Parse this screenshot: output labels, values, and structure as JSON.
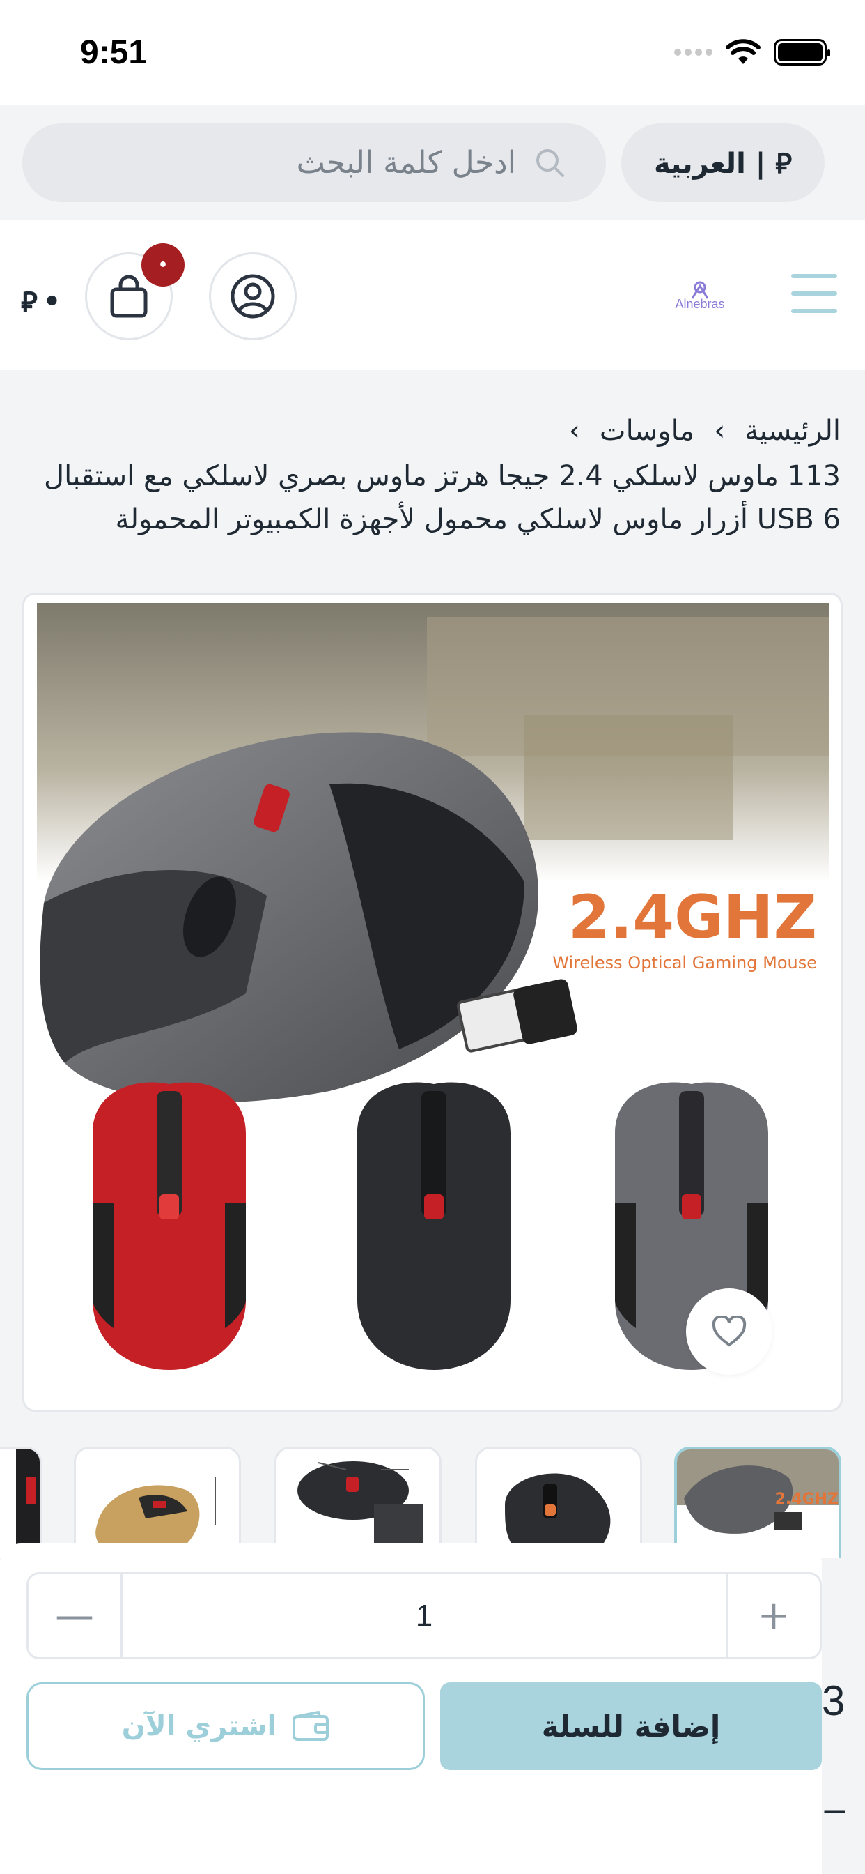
{
  "status_bar": {
    "time": "9:51"
  },
  "top_bar": {
    "language_currency": "العربية | ⃁",
    "search_placeholder": "ادخل كلمة البحث"
  },
  "header": {
    "logo_text": "Alnebras",
    "cart_badge": "•",
    "cart_total": "•",
    "currency_symbol": "⃁"
  },
  "breadcrumb": {
    "items": [
      "الرئيسية",
      "ماوسات"
    ],
    "separator": "›"
  },
  "product": {
    "title": "113 ماوس لاسلكي 2.4 جيجا هرتز ماوس بصري لاسلكي مع استقبال USB 6 أزرار ماوس لاسلكي محمول لأجهزة الكمبيوتر المحمولة",
    "image_headline": "2.4GHZ",
    "image_subtitle": "Wireless Optical Gaming Mouse"
  },
  "purchase": {
    "quantity": "1",
    "minus": "—",
    "plus": "+",
    "buy_now": "اشتري الآن",
    "add_to_cart": "إضافة للسلة"
  },
  "edge": {
    "char1": "3",
    "char2": "ــ"
  },
  "colors": {
    "accent": "#a9d4dd",
    "accent_outline": "#9ccfd9",
    "badge": "#a51f22",
    "background_gray": "#f3f4f6",
    "mouse_red": "#c52026",
    "mouse_gray": "#6b6c70",
    "headline_orange": "#e2763a"
  }
}
